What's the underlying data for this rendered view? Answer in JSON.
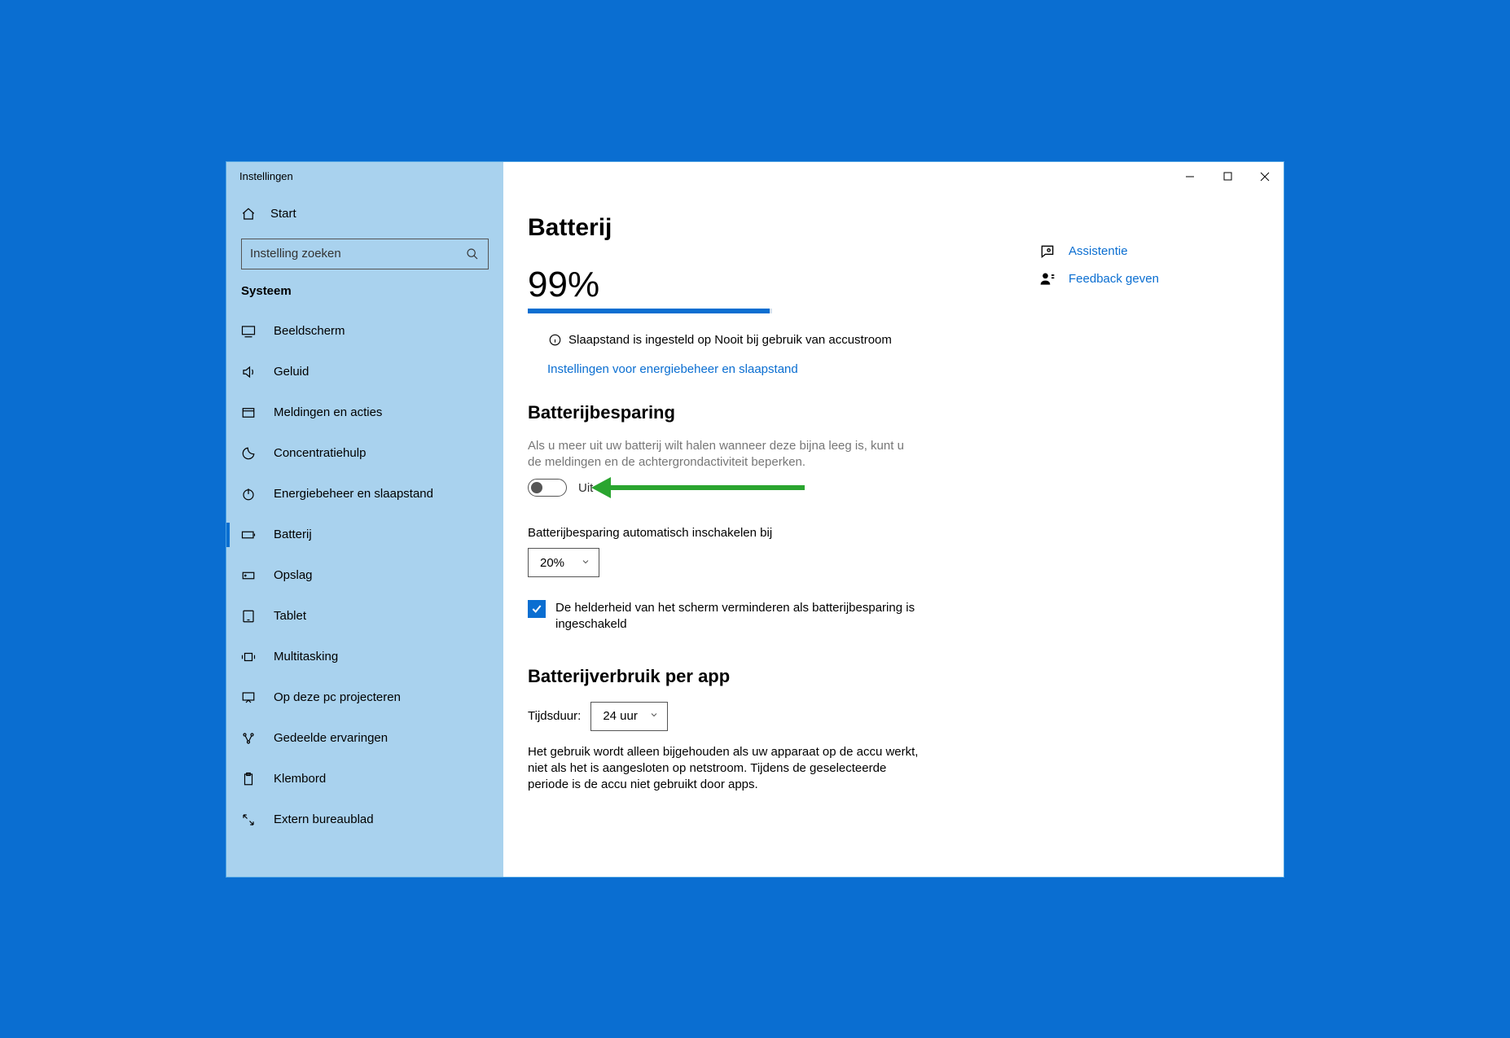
{
  "window_title": "Instellingen",
  "sidebar": {
    "home_label": "Start",
    "search_placeholder": "Instelling zoeken",
    "category": "Systeem",
    "items": [
      {
        "icon": "display",
        "label": "Beeldscherm"
      },
      {
        "icon": "sound",
        "label": "Geluid"
      },
      {
        "icon": "notif",
        "label": "Meldingen en acties"
      },
      {
        "icon": "moon",
        "label": "Concentratiehulp"
      },
      {
        "icon": "power",
        "label": "Energiebeheer en slaapstand"
      },
      {
        "icon": "battery",
        "label": "Batterij"
      },
      {
        "icon": "storage",
        "label": "Opslag"
      },
      {
        "icon": "tablet",
        "label": "Tablet"
      },
      {
        "icon": "multitask",
        "label": "Multitasking"
      },
      {
        "icon": "project",
        "label": "Op deze pc projecteren"
      },
      {
        "icon": "shared",
        "label": "Gedeelde ervaringen"
      },
      {
        "icon": "clipboard",
        "label": "Klembord"
      },
      {
        "icon": "remote",
        "label": "Extern bureaublad"
      }
    ]
  },
  "page": {
    "title": "Batterij",
    "percent_label": "99%",
    "percent_value": 99,
    "sleep_notice": "Slaapstand is ingesteld op Nooit bij gebruik van accustroom",
    "energy_link": "Instellingen voor energiebeheer en slaapstand",
    "saver": {
      "title": "Batterijbesparing",
      "desc": "Als u meer uit uw batterij wilt halen wanneer deze bijna leeg is, kunt u de meldingen en de achtergrondactiviteit beperken.",
      "toggle_state": "Uit",
      "auto_label": "Batterijbesparing automatisch inschakelen bij",
      "auto_value": "20%",
      "dim_checked": true,
      "dim_label": "De helderheid van het scherm verminderen als batterijbesparing is ingeschakeld"
    },
    "usage": {
      "title": "Batterijverbruik per app",
      "duration_label": "Tijdsduur:",
      "duration_value": "24 uur",
      "body": "Het gebruik wordt alleen bijgehouden als uw apparaat op de accu werkt, niet als het is aangesloten op netstroom. Tijdens de geselecteerde periode is de accu niet gebruikt door apps."
    }
  },
  "aside": {
    "help": "Assistentie",
    "feedback": "Feedback geven"
  }
}
